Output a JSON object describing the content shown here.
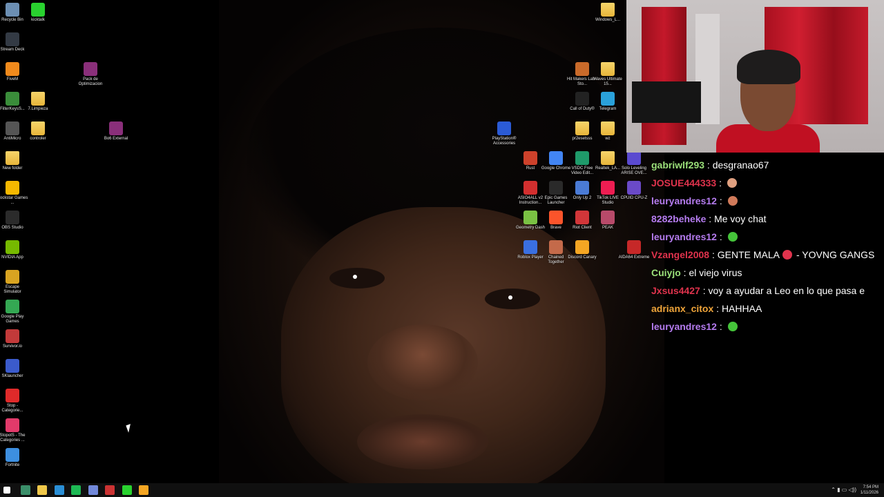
{
  "desktop": {
    "left_icons": [
      {
        "label": "Recycle Bin",
        "icon": "recycle-bin-icon",
        "color": "#6c8fb3"
      },
      {
        "label": "kicktalk",
        "icon": "kick-icon",
        "color": "#29d22f"
      },
      {
        "label": "Stream Deck",
        "icon": "stream-deck-icon",
        "color": "#333a44"
      },
      {
        "label": "FiveM",
        "icon": "fivem-icon",
        "color": "#f08a1c"
      },
      {
        "label": "Pack de Optimizacion",
        "icon": "winrar-icon",
        "color": "#8a2f7a"
      },
      {
        "label": "FilterKeysS...",
        "icon": "app-icon",
        "color": "#3a8d3a"
      },
      {
        "label": "7.Limpieza",
        "icon": "folder-icon",
        "color": "#f0c84a"
      },
      {
        "label": "AntiMicro",
        "icon": "gamepad-icon",
        "color": "#555"
      },
      {
        "label": "controler",
        "icon": "folder-icon",
        "color": "#f0c84a"
      },
      {
        "label": "Bo6 External",
        "icon": "winrar-icon",
        "color": "#8a2f7a"
      },
      {
        "label": "New folder",
        "icon": "folder-icon",
        "color": "#f0c84a"
      },
      {
        "label": "Rockstar Games ...",
        "icon": "rockstar-icon",
        "color": "#f5b800"
      },
      {
        "label": "OBS Studio",
        "icon": "obs-icon",
        "color": "#2b2b2b"
      },
      {
        "label": "NVIDIA App",
        "icon": "nvidia-icon",
        "color": "#76b900"
      },
      {
        "label": "Escape Simulator",
        "icon": "game-icon",
        "color": "#d9a421"
      },
      {
        "label": "Google Play Games",
        "icon": "play-games-icon",
        "color": "#34a853"
      },
      {
        "label": "Survivor.io",
        "icon": "game-icon",
        "color": "#c23a3a"
      },
      {
        "label": "SKlauncher",
        "icon": "launcher-icon",
        "color": "#3b5bcc"
      },
      {
        "label": "Stop - Categorie...",
        "icon": "game-icon",
        "color": "#e02a2a"
      },
      {
        "label": "StopotS - The Categories ...",
        "icon": "game-icon",
        "color": "#e23a6a"
      },
      {
        "label": "Fortnite",
        "icon": "fortnite-icon",
        "color": "#3d8fe0"
      }
    ],
    "right_icons": [
      {
        "label": "Windows_L...",
        "icon": "folder-icon",
        "color": "#f0c84a"
      },
      {
        "label": "Hit Makers Lab - Sto...",
        "icon": "app-icon",
        "color": "#c96a2a"
      },
      {
        "label": "Waves Ultimate 15...",
        "icon": "folder-icon",
        "color": "#f0c84a"
      },
      {
        "label": "Call of Duty®",
        "icon": "cod-icon",
        "color": "#222"
      },
      {
        "label": "Telegram",
        "icon": "telegram-icon",
        "color": "#2aa1da"
      },
      {
        "label": "PlayStation® Accessories",
        "icon": "playstation-icon",
        "color": "#2b5bd6"
      },
      {
        "label": "pr2esetsss",
        "icon": "folder-icon",
        "color": "#f0c84a"
      },
      {
        "label": "wz",
        "icon": "folder-icon",
        "color": "#f0c84a"
      },
      {
        "label": "Rust",
        "icon": "rust-icon",
        "color": "#cd412b"
      },
      {
        "label": "Google Chrome",
        "icon": "chrome-icon",
        "color": "#4285f4"
      },
      {
        "label": "VSDC Free Video Edit...",
        "icon": "vsdc-icon",
        "color": "#1f9a6a"
      },
      {
        "label": "Realtek_LA...",
        "icon": "folder-icon",
        "color": "#f0c84a"
      },
      {
        "label": "Solo Leveling ARISE OVE...",
        "icon": "game-icon",
        "color": "#5a4ad0"
      },
      {
        "label": "ASIO4ALL v2 Instruction...",
        "icon": "pdf-icon",
        "color": "#d32f2f"
      },
      {
        "label": "Epic Games Launcher",
        "icon": "epic-icon",
        "color": "#2a2a2a"
      },
      {
        "label": "Only Up 2",
        "icon": "game-icon",
        "color": "#4a7bd6"
      },
      {
        "label": "TikTok LIVE Studio",
        "icon": "tiktok-icon",
        "color": "#ee1d52"
      },
      {
        "label": "CPUID CPU-Z",
        "icon": "cpuz-icon",
        "color": "#6a4ac8"
      },
      {
        "label": "Geometry Dash",
        "icon": "geometry-dash-icon",
        "color": "#7ac143"
      },
      {
        "label": "Brave",
        "icon": "brave-icon",
        "color": "#fb542b"
      },
      {
        "label": "Riot Client",
        "icon": "riot-icon",
        "color": "#d13639"
      },
      {
        "label": "PEAK",
        "icon": "peak-icon",
        "color": "#b84a6a"
      },
      {
        "label": "Roblox Player",
        "icon": "roblox-icon",
        "color": "#3a6fe0"
      },
      {
        "label": "Chained Together",
        "icon": "game-icon",
        "color": "#c46a4a"
      },
      {
        "label": "Discord Canary",
        "icon": "discord-icon",
        "color": "#f5a623"
      },
      {
        "label": "AIDA64 Extreme",
        "icon": "aida64-icon",
        "color": "#c62828"
      }
    ]
  },
  "chat": {
    "messages": [
      {
        "user": "gabriwlf293",
        "user_color": "#9be07a",
        "text": "desgranao67",
        "emote": null
      },
      {
        "user": "JOSUE444333",
        "user_color": "#e0334d",
        "text": "",
        "emote": "#e0a080"
      },
      {
        "user": "leuryandres12",
        "user_color": "#b57cf0",
        "text": "",
        "emote": "#d07a5a"
      },
      {
        "user": "8282beheke",
        "user_color": "#b57cf0",
        "text": "Me voy chat",
        "emote": null
      },
      {
        "user": "leuryandres12",
        "user_color": "#b57cf0",
        "text": "",
        "emote": "#45c43a"
      },
      {
        "user": "Vzangel2008",
        "user_color": "#e0334d",
        "text": "GENTE MALA",
        "emote": "#e0334d",
        "text_after": "- YOVNG GANGS"
      },
      {
        "user": "Cuiyjo",
        "user_color": "#9be07a",
        "text": "el viejo virus",
        "emote": null
      },
      {
        "user": "Jxsus4427",
        "user_color": "#e0334d",
        "text": "voy a ayudar a Leo en lo que pasa e",
        "emote": null
      },
      {
        "user": "adrianx_citox",
        "user_color": "#f0a53a",
        "text": "HAHHAA",
        "emote": null
      },
      {
        "user": "leuryandres12",
        "user_color": "#b57cf0",
        "text": "",
        "emote": "#45c43a"
      }
    ]
  },
  "taskbar": {
    "apps": [
      {
        "name": "start-button",
        "color": "#ffffff"
      },
      {
        "name": "terminal-app",
        "color": "#3b8f6a"
      },
      {
        "name": "file-explorer-app",
        "color": "#f0c84a"
      },
      {
        "name": "edge-app",
        "color": "#2a8fd6"
      },
      {
        "name": "spotify-app",
        "color": "#1db954"
      },
      {
        "name": "discord-app",
        "color": "#7289da"
      },
      {
        "name": "obs-app",
        "color": "#cc3333"
      },
      {
        "name": "kick-app",
        "color": "#29d22f"
      },
      {
        "name": "chrome-app",
        "color": "#f5a623"
      }
    ],
    "clock_time": "7:54 PM",
    "clock_date": "1/11/2026"
  }
}
